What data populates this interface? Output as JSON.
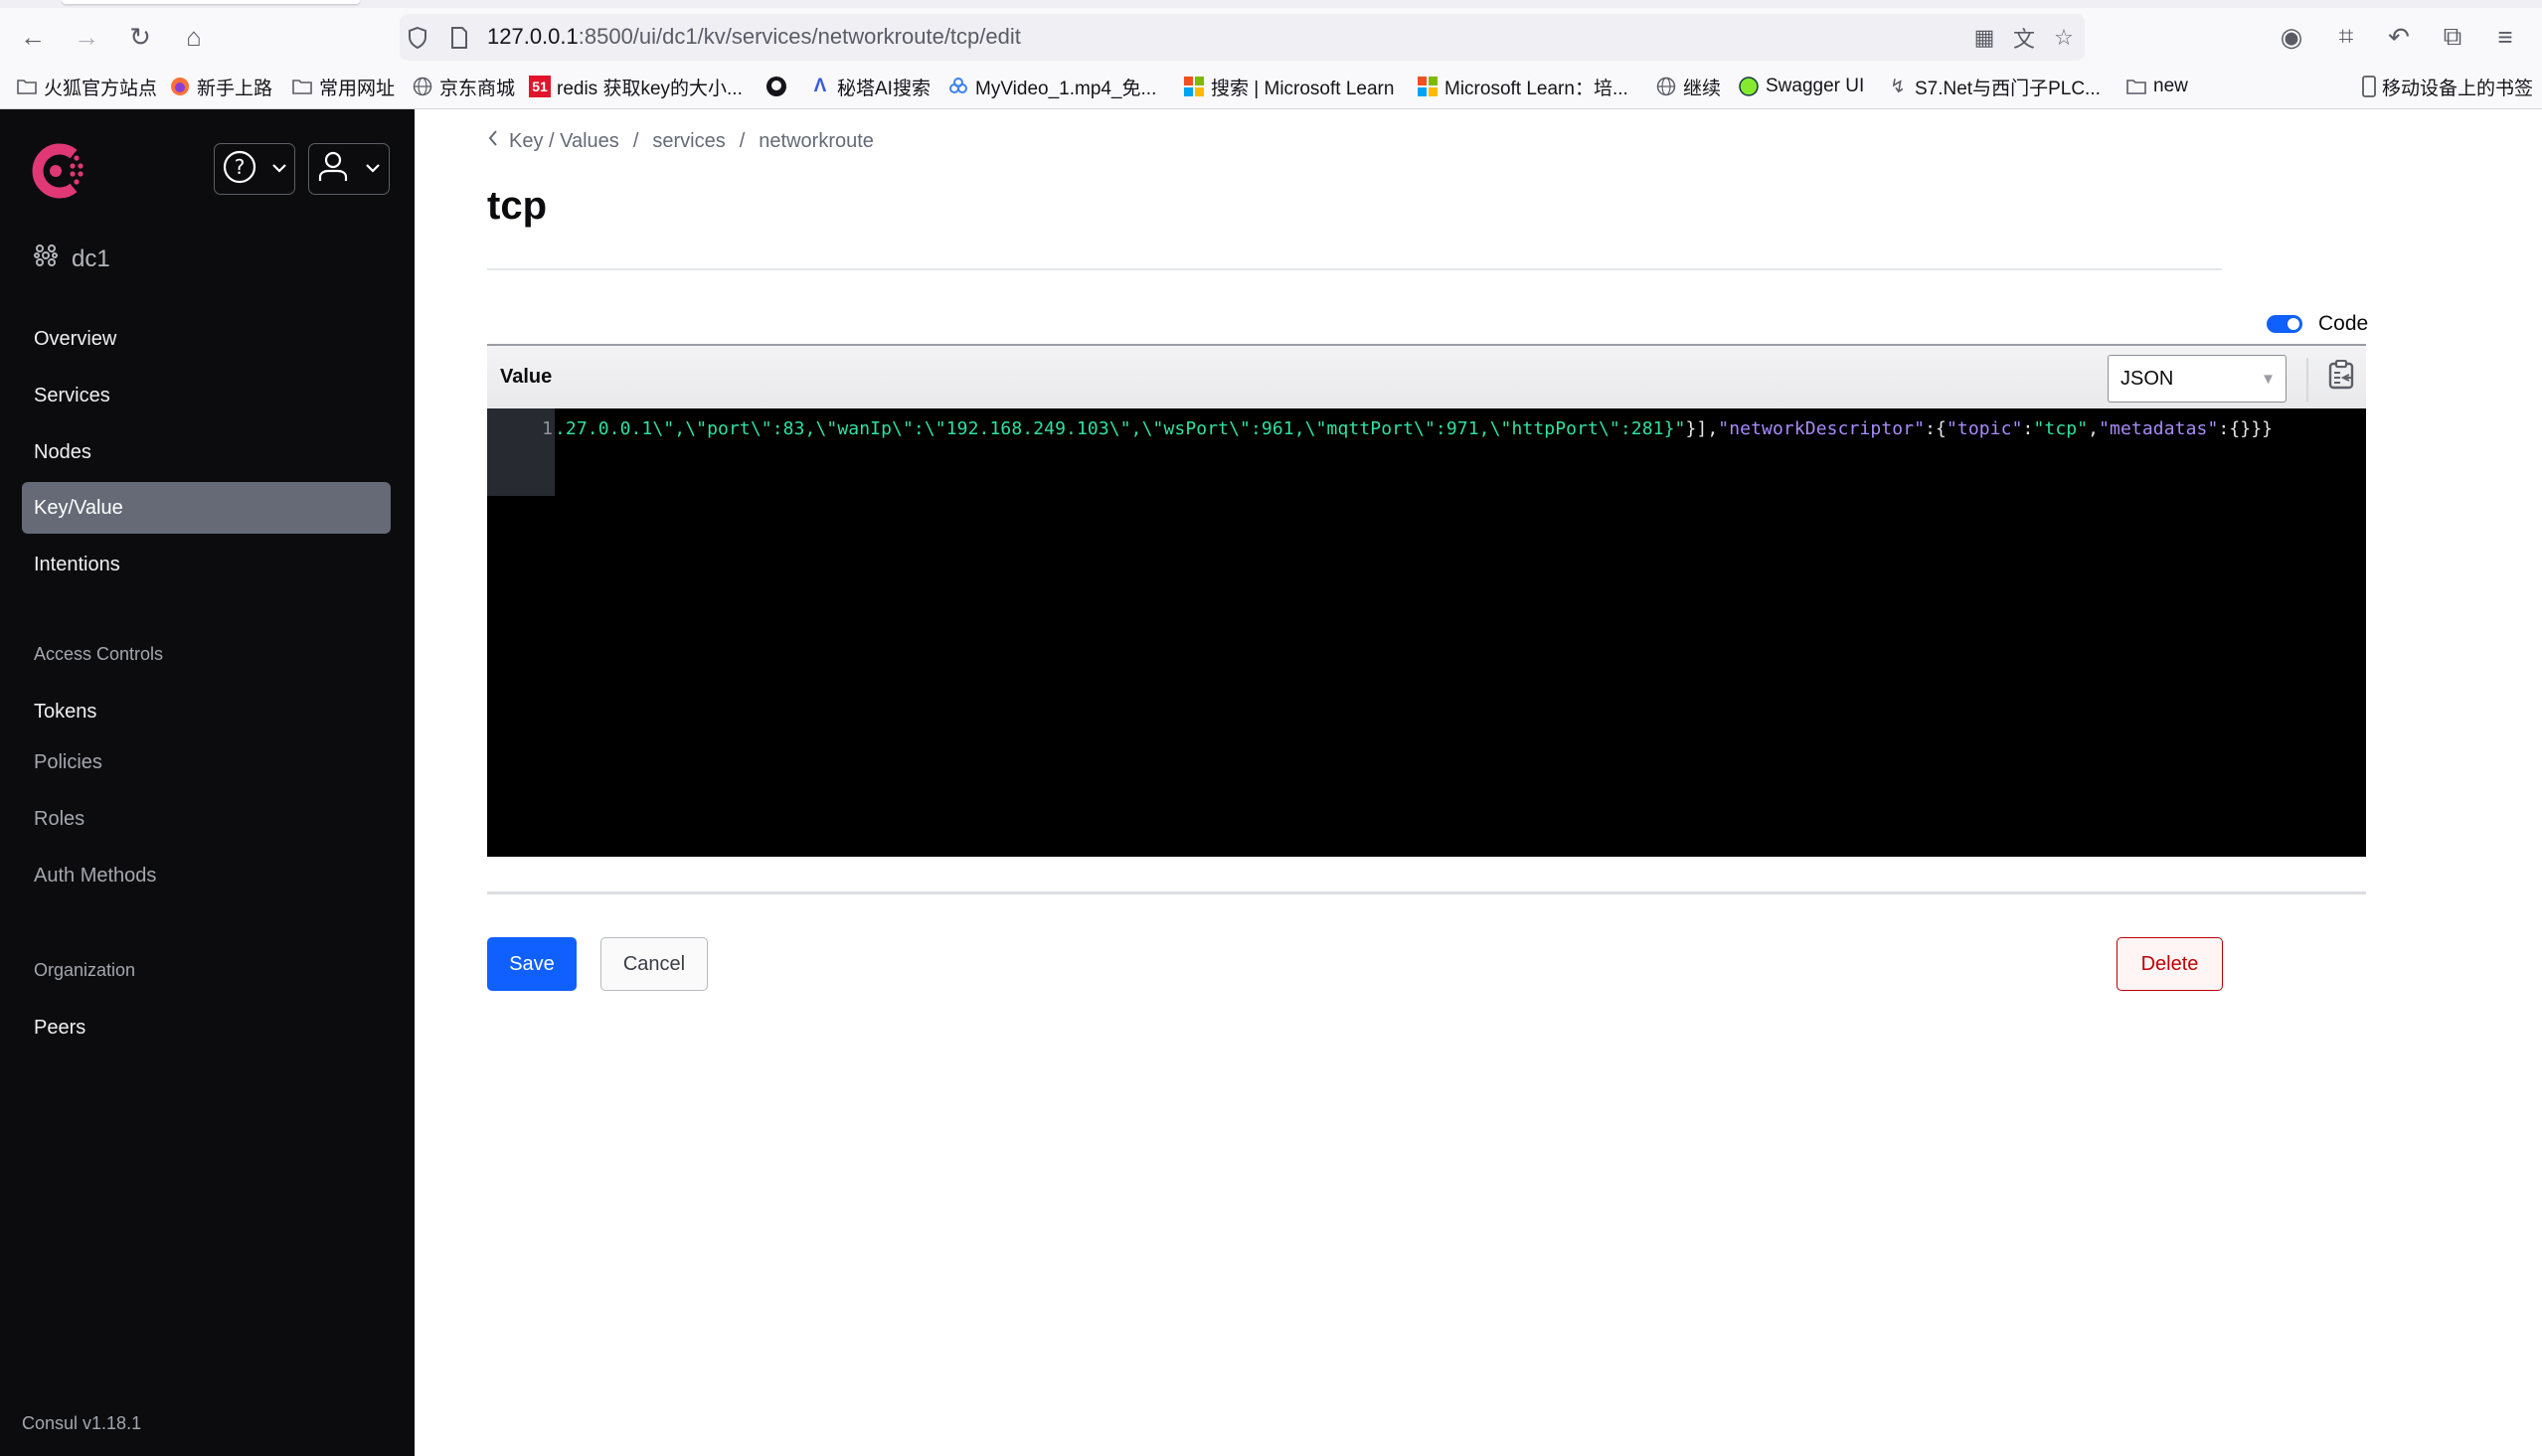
{
  "browser": {
    "url_host": "127.0.0.1",
    "url_rest": ":8500/ui/dc1/kv/services/networkroute/tcp/edit",
    "bookmarks": [
      {
        "icon": "folder-icon",
        "label": "火狐官方站点"
      },
      {
        "icon": "firefox-icon",
        "label": "新手上路"
      },
      {
        "icon": "folder-icon",
        "label": "常用网址"
      },
      {
        "icon": "globe-icon",
        "label": "京东商城"
      },
      {
        "icon": "51-icon",
        "label": "redis 获取key的大小..."
      },
      {
        "icon": "github-icon",
        "label": ""
      },
      {
        "icon": "metaso-icon",
        "label": "秘塔AI搜索"
      },
      {
        "icon": "video-icon",
        "label": "MyVideo_1.mp4_免..."
      },
      {
        "icon": "microsoft-icon",
        "label": "搜索 | Microsoft Learn"
      },
      {
        "icon": "microsoft-icon",
        "label": "Microsoft Learn：培..."
      },
      {
        "icon": "globe-icon",
        "label": "继续"
      },
      {
        "icon": "swagger-icon",
        "label": "Swagger UI"
      },
      {
        "icon": "s7-icon",
        "label": "S7.Net与西门子PLC..."
      },
      {
        "icon": "folder-icon",
        "label": "new"
      }
    ],
    "mobile_bookmarks": "移动设备上的书签"
  },
  "sidebar": {
    "datacenter": "dc1",
    "items": [
      {
        "label": "Overview",
        "active": false
      },
      {
        "label": "Services",
        "active": false
      },
      {
        "label": "Nodes",
        "active": false
      },
      {
        "label": "Key/Value",
        "active": true
      },
      {
        "label": "Intentions",
        "active": false
      }
    ],
    "access_heading": "Access Controls",
    "access_items": [
      {
        "label": "Tokens"
      },
      {
        "label": "Policies"
      },
      {
        "label": "Roles"
      },
      {
        "label": "Auth Methods"
      }
    ],
    "org_heading": "Organization",
    "org_items": [
      {
        "label": "Peers"
      }
    ],
    "version": "Consul v1.18.1"
  },
  "main": {
    "breadcrumb": [
      "Key / Values",
      "services",
      "networkroute"
    ],
    "title": "tcp",
    "code_toggle_label": "Code",
    "code_toggle_on": true,
    "value_label": "Value",
    "format_select": "JSON",
    "editor": {
      "line_number": "1",
      "segments": [
        {
          "cls": "s",
          "text": ".27.0.0.1\\\",\\\"port\\\":83,\\\"wanIp\\\":\\\"192.168.249.103\\\",\\\"wsPort\\\":961,\\\"mqttPort\\\":971,\\\"httpPort\\\":281}\""
        },
        {
          "cls": "p",
          "text": "}],"
        },
        {
          "cls": "k",
          "text": "\"networkDescriptor\""
        },
        {
          "cls": "p",
          "text": ":{"
        },
        {
          "cls": "k",
          "text": "\"topic\""
        },
        {
          "cls": "p",
          "text": ":"
        },
        {
          "cls": "s",
          "text": "\"tcp\""
        },
        {
          "cls": "p",
          "text": ","
        },
        {
          "cls": "k",
          "text": "\"metadatas\""
        },
        {
          "cls": "p",
          "text": ":{}}}"
        }
      ]
    },
    "save_label": "Save",
    "cancel_label": "Cancel",
    "delete_label": "Delete"
  }
}
